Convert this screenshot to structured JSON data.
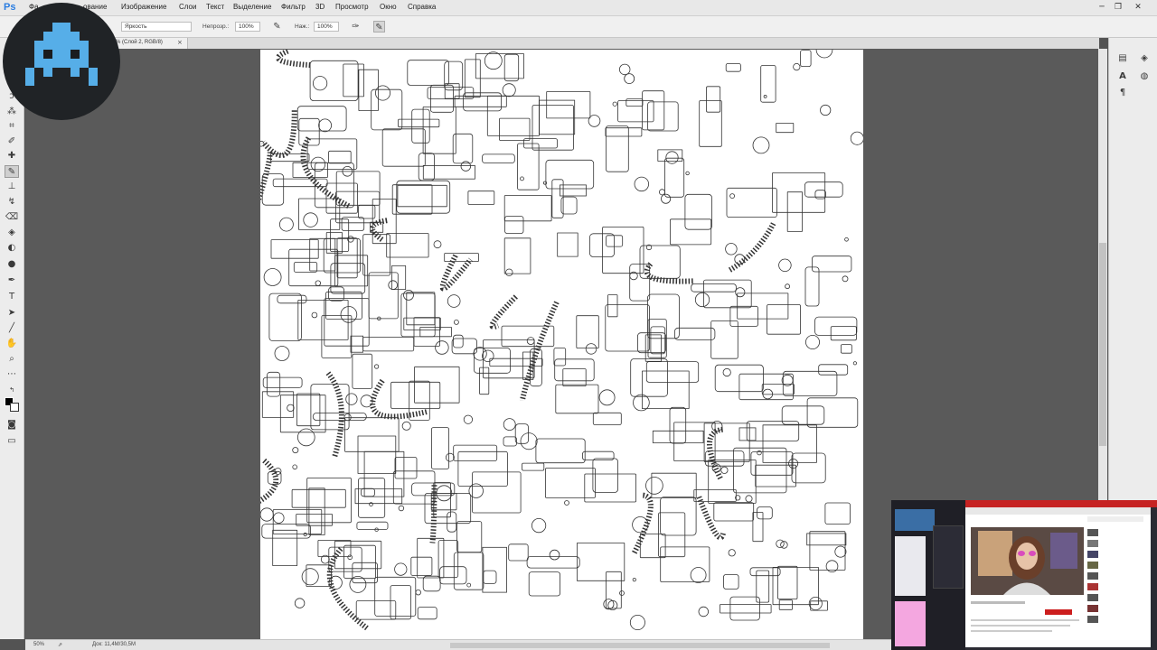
{
  "app": {
    "logo": "Ps",
    "accent": "#2a7de1"
  },
  "menu": {
    "items": [
      "Файл",
      "Редактирование",
      "Изображение",
      "Слои",
      "Текст",
      "Выделение",
      "Фильтр",
      "3D",
      "Просмотр",
      "Окно",
      "Справка"
    ],
    "visible_labels": [
      "Фа",
      "ование",
      "Изображение",
      "Слои",
      "Текст",
      "Выделение",
      "Фильтр",
      "3D",
      "Просмотр",
      "Окно",
      "Справка"
    ]
  },
  "window_controls": {
    "minimize": "─",
    "restore": "❐",
    "close": "✕"
  },
  "options": {
    "mode_value": "Яркость",
    "opacity_label": "Непрозр.:",
    "opacity_value": "100%",
    "flow_label": "Наж.:",
    "flow_value": "100%"
  },
  "document": {
    "tab_label": "% (Слой 2, RGB/8)",
    "close": "×"
  },
  "status": {
    "zoom": "50%",
    "doc_info": "Док: 11,4M/30,5M"
  },
  "pip": {
    "tab_color": "#c62222"
  },
  "colors": {
    "foreground": "#000000",
    "background": "#ffffff"
  }
}
